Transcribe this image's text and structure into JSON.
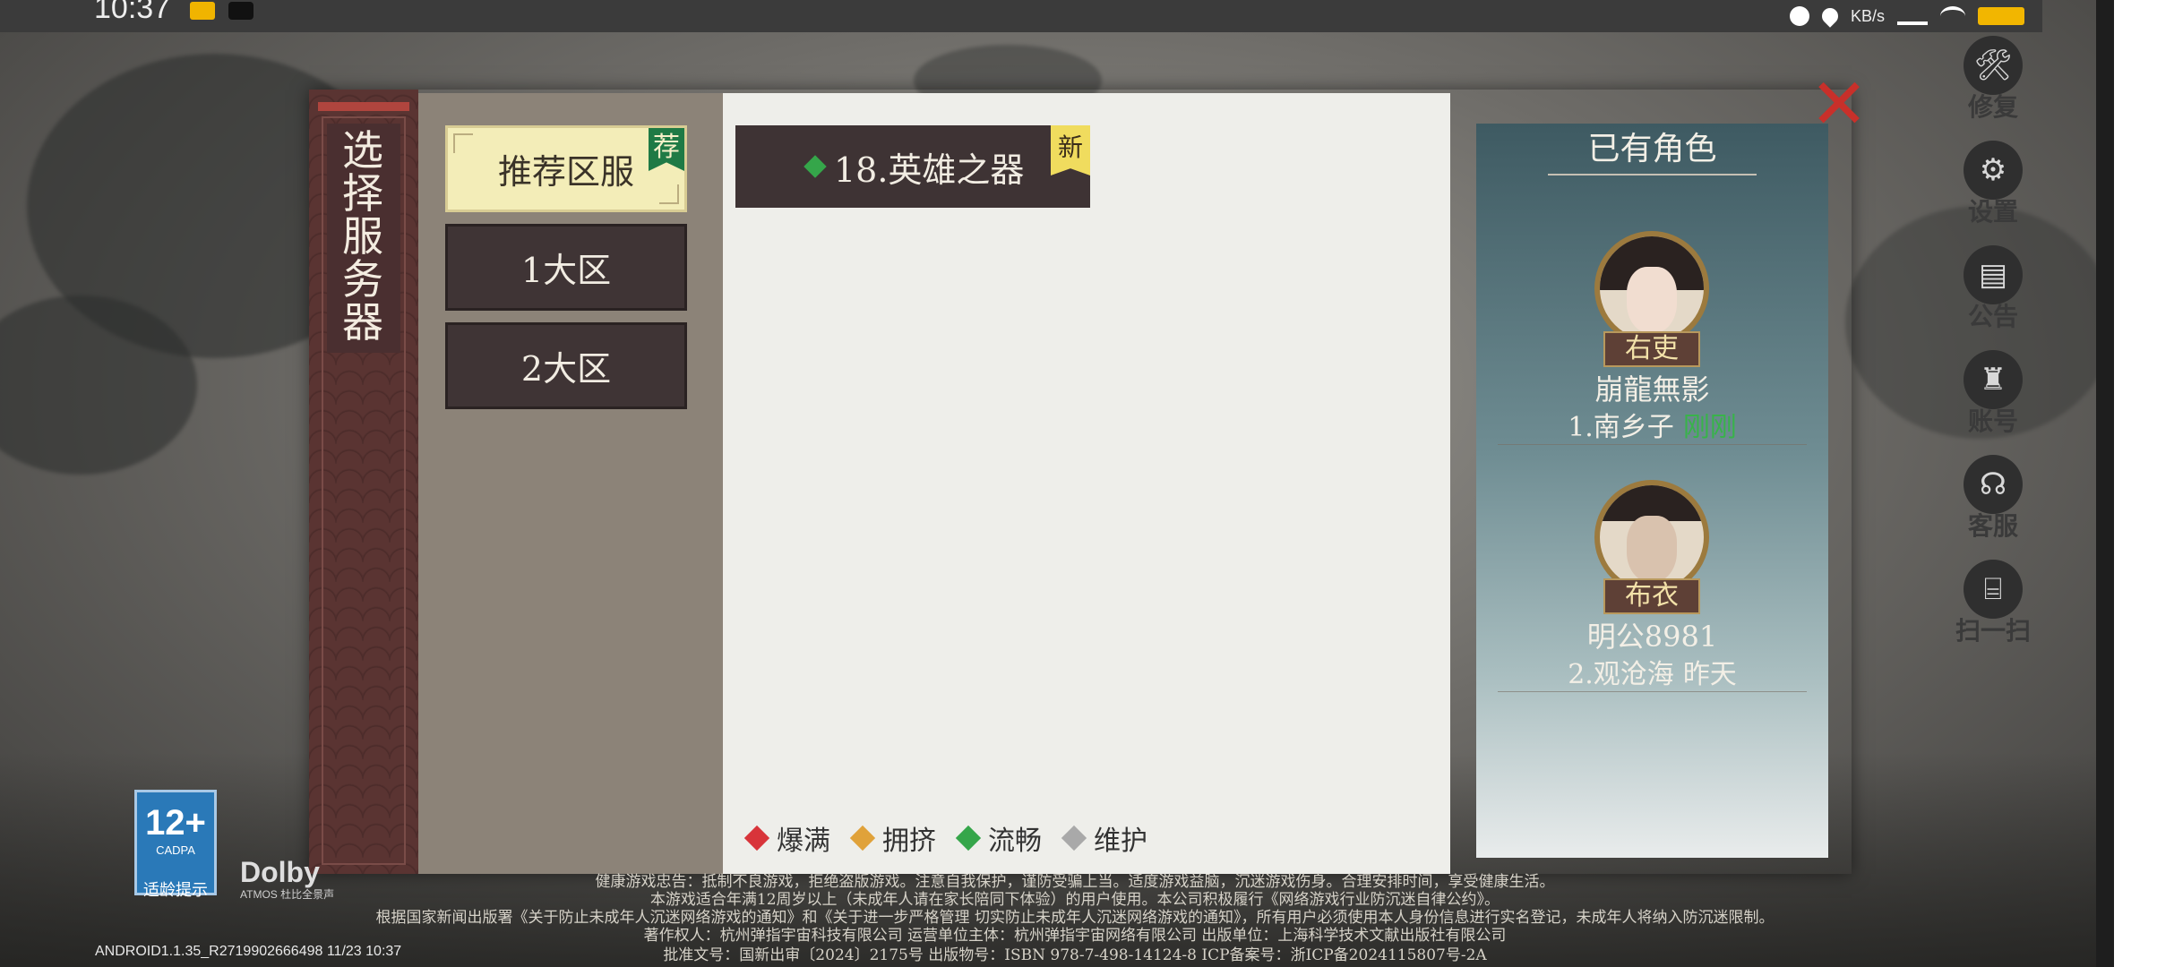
{
  "status_bar": {
    "time": "10:37",
    "net_speed": "KB/s"
  },
  "side_menu": [
    {
      "label": "修复",
      "icon": "wrench-icon"
    },
    {
      "label": "设置",
      "icon": "gear-icon"
    },
    {
      "label": "公告",
      "icon": "notice-icon"
    },
    {
      "label": "账号",
      "icon": "account-icon"
    },
    {
      "label": "客服",
      "icon": "headset-icon"
    },
    {
      "label": "扫一扫",
      "icon": "scan-icon"
    }
  ],
  "dialog": {
    "title": "选择服务器",
    "zones": [
      {
        "label": "推荐区服",
        "badge": "荐"
      },
      {
        "label": "1大区"
      },
      {
        "label": "2大区"
      }
    ],
    "server": {
      "label": "18.英雄之器",
      "badge": "新",
      "status_color": "#35a64a"
    },
    "legend": [
      {
        "label": "爆满",
        "color": "#d8343a"
      },
      {
        "label": "拥挤",
        "color": "#e0a23a"
      },
      {
        "label": "流畅",
        "color": "#35a64a"
      },
      {
        "label": "维护",
        "color": "#a9a9a9"
      }
    ],
    "existing_roles": {
      "title": "已有角色",
      "characters": [
        {
          "role": "右吏",
          "name": "崩龍無影",
          "server": "1.南乡子",
          "time": "刚刚"
        },
        {
          "role": "布衣",
          "name": "明公8981",
          "server": "2.观沧海",
          "time": "昨天"
        }
      ]
    }
  },
  "footer": {
    "age_rating": "12+",
    "age_org": "CADPA",
    "age_tip": "适龄提示",
    "dolby": "Dolby",
    "dolby_sub": "ATMOS 杜比全景声",
    "line1": "健康游戏忠告：抵制不良游戏，拒绝盗版游戏。注意自我保护，谨防受骗上当。适度游戏益脑，沉迷游戏伤身。合理安排时间，享受健康生活。",
    "line2": "本游戏适合年满12周岁以上（未成年人请在家长陪同下体验）的用户使用。本公司积极履行《网络游戏行业防沉迷自律公约》。",
    "line3": "根据国家新闻出版署《关于防止未成年人沉迷网络游戏的通知》和《关于进一步严格管理 切实防止未成年人沉迷网络游戏的通知》，所有用户必须使用本人身份信息进行实名登记，未成年人将纳入防沉迷限制。",
    "line4": "著作权人：杭州弹指宇宙科技有限公司    运营单位主体：杭州弹指宇宙网络有限公司    出版单位：上海科学技术文献出版社有限公司",
    "line5": "批准文号：国新出审〔2024〕2175号    出版物号：ISBN 978-7-498-14124-8    ICP备案号：浙ICP备2024115807号-2A",
    "version": "ANDROID1.1.35_R2719902666498 11/23 10:37"
  }
}
